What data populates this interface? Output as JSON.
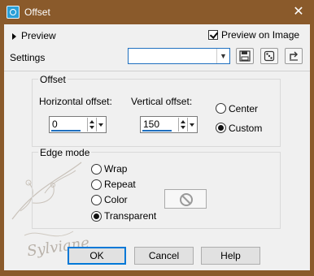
{
  "window": {
    "title": "Offset",
    "close_glyph": "✕"
  },
  "preview": {
    "label": "Preview",
    "preview_on_image_label": "Preview on Image",
    "preview_on_image_checked": true
  },
  "settings": {
    "label": "Settings",
    "value": ""
  },
  "offset": {
    "title": "Offset",
    "horizontal_label": "Horizontal offset:",
    "horizontal_value": "0",
    "vertical_label": "Vertical offset:",
    "vertical_value": "150",
    "center_label": "Center",
    "custom_label": "Custom",
    "selected": "Custom"
  },
  "edge_mode": {
    "title": "Edge mode",
    "options": [
      "Wrap",
      "Repeat",
      "Color",
      "Transparent"
    ],
    "selected": "Transparent"
  },
  "watermark": {
    "text": "Sylviane"
  },
  "buttons": {
    "ok": "OK",
    "cancel": "Cancel",
    "help": "Help"
  },
  "colors": {
    "frame": "#8a5a2b",
    "accent": "#1e6fbf",
    "panel": "#f0f0f0"
  }
}
